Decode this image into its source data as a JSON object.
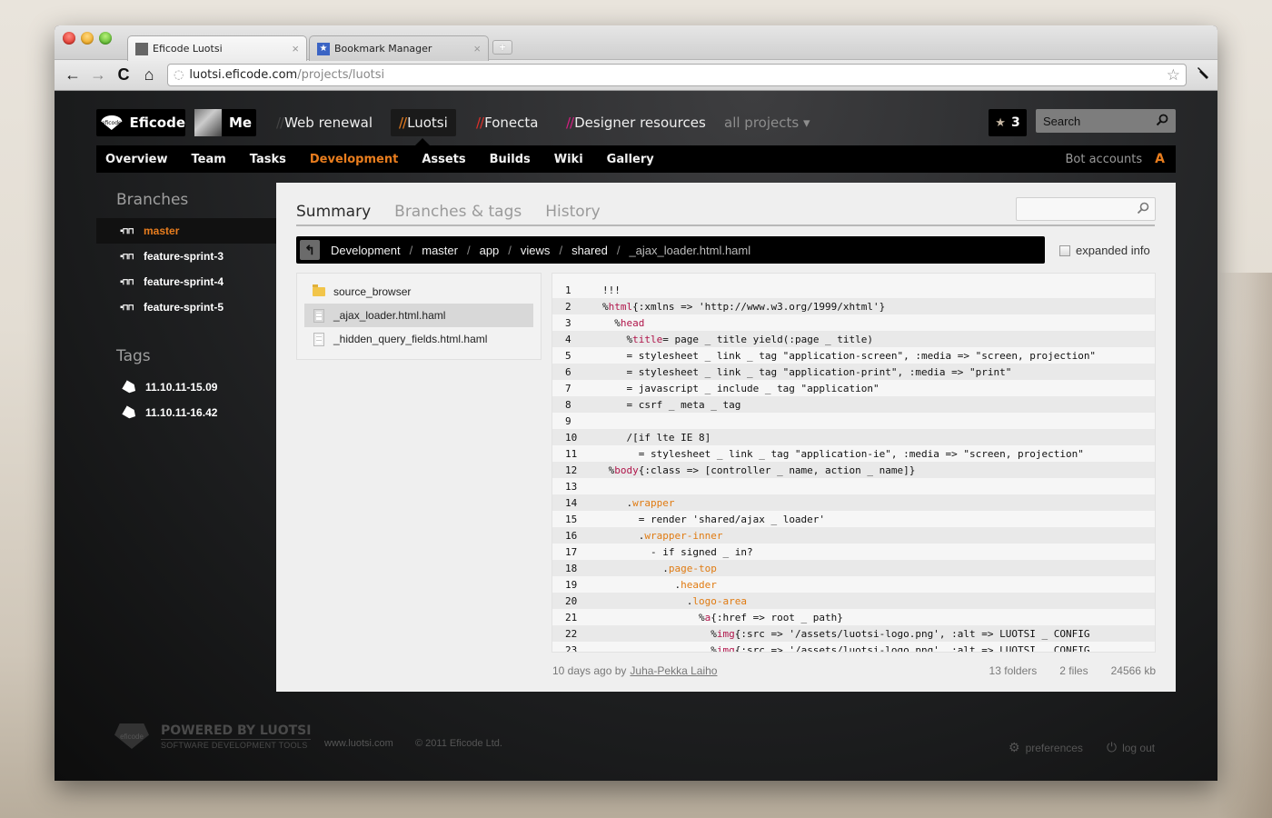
{
  "browser": {
    "tabs": [
      {
        "label": "Eficode Luotsi",
        "favicon": "eficode-favicon",
        "active": true
      },
      {
        "label": "Bookmark Manager",
        "favicon": "bookmark-star-favicon",
        "active": false
      }
    ],
    "tab_close_glyph": "×",
    "new_tab_glyph": "+",
    "url_host": "luotsi.eficode.com",
    "url_path": "/projects/luotsi",
    "icons": {
      "back": "←",
      "forward": "→",
      "reload": "C",
      "home": "⌂",
      "globe": "◌",
      "bookmark_star": "☆",
      "wrench": "🔧"
    }
  },
  "topnav": {
    "logo_label": "Eficode",
    "logo_mark_text": "eficode",
    "me_label": "Me",
    "projects": [
      {
        "slashes": "//",
        "label": "Web renewal",
        "slash_color": "#444444",
        "active": false
      },
      {
        "slashes": "//",
        "label": "Luotsi",
        "slash_color": "#e87d1e",
        "active": true
      },
      {
        "slashes": "//",
        "label": "Fonecta",
        "slash_color": "#e0302a",
        "active": false
      },
      {
        "slashes": "//",
        "label": "Designer resources",
        "slash_color": "#d61f83",
        "active": false
      }
    ],
    "all_projects_label": "all projects ▾",
    "starred_count": "3",
    "star_glyph": "★",
    "search_placeholder": "Search",
    "search_glyph": "⚲"
  },
  "subnav": {
    "items": [
      {
        "label": "Overview",
        "active": false
      },
      {
        "label": "Team",
        "active": false
      },
      {
        "label": "Tasks",
        "active": false
      },
      {
        "label": "Development",
        "active": true
      },
      {
        "label": "Assets",
        "active": false
      },
      {
        "label": "Builds",
        "active": false
      },
      {
        "label": "Wiki",
        "active": false
      },
      {
        "label": "Gallery",
        "active": false
      }
    ],
    "bot_accounts_label": "Bot accounts",
    "bot_accounts_badge": "A"
  },
  "sidebar": {
    "branches_heading": "Branches",
    "branches": [
      {
        "label": "master",
        "active": true
      },
      {
        "label": "feature-sprint-3",
        "active": false
      },
      {
        "label": "feature-sprint-4",
        "active": false
      },
      {
        "label": "feature-sprint-5",
        "active": false
      }
    ],
    "branch_glyph": "▪⁂",
    "tags_heading": "Tags",
    "tags": [
      {
        "label": "11.10.11-15.09"
      },
      {
        "label": "11.10.11-16.42"
      }
    ]
  },
  "main": {
    "tabs": [
      {
        "label": "Summary",
        "active": true
      },
      {
        "label": "Branches & tags",
        "active": false
      },
      {
        "label": "History",
        "active": false
      }
    ],
    "search_value": "",
    "search_glyph": "⚲",
    "back_glyph": "↰",
    "breadcrumb": [
      "Development",
      "master",
      "app",
      "views",
      "shared",
      "_ajax_loader.html.haml"
    ],
    "breadcrumb_sep": "/",
    "expanded_info_label": "expanded info",
    "expanded_info_checked": false,
    "files": [
      {
        "name": "source_browser",
        "type": "folder",
        "selected": false
      },
      {
        "name": "_ajax_loader.html.haml",
        "type": "file",
        "selected": true
      },
      {
        "name": "_hidden_query_fields.html.haml",
        "type": "file",
        "selected": false
      }
    ],
    "code_lines": [
      {
        "n": "1",
        "indent": 0,
        "parts": [
          {
            "t": "!!!"
          }
        ]
      },
      {
        "n": "2",
        "indent": 0,
        "parts": [
          {
            "t": "%"
          },
          {
            "t": "html",
            "c": "kw"
          },
          {
            "t": "{:xmlns => 'http://www.w3.org/1999/xhtml'}"
          }
        ]
      },
      {
        "n": "3",
        "indent": 2,
        "parts": [
          {
            "t": "%"
          },
          {
            "t": "head",
            "c": "kw"
          }
        ]
      },
      {
        "n": "4",
        "indent": 4,
        "parts": [
          {
            "t": "%"
          },
          {
            "t": "title",
            "c": "kw"
          },
          {
            "t": "= page _ title yield(:page _ title)"
          }
        ]
      },
      {
        "n": "5",
        "indent": 4,
        "parts": [
          {
            "t": "= stylesheet _ link _ tag \"application-screen\", :media => \"screen, projection\""
          }
        ]
      },
      {
        "n": "6",
        "indent": 4,
        "parts": [
          {
            "t": "= stylesheet _ link _ tag \"application-print\", :media => \"print\""
          }
        ]
      },
      {
        "n": "7",
        "indent": 4,
        "parts": [
          {
            "t": "= javascript _ include _ tag \"application\""
          }
        ]
      },
      {
        "n": "8",
        "indent": 4,
        "parts": [
          {
            "t": "= csrf _ meta _ tag"
          }
        ]
      },
      {
        "n": "9",
        "indent": 0,
        "parts": [
          {
            "t": ""
          }
        ]
      },
      {
        "n": "10",
        "indent": 4,
        "parts": [
          {
            "t": "/[if lte IE 8]"
          }
        ]
      },
      {
        "n": "11",
        "indent": 6,
        "parts": [
          {
            "t": "= stylesheet _ link _ tag \"application-ie\", :media => \"screen, projection\""
          }
        ]
      },
      {
        "n": "12",
        "indent": 1,
        "parts": [
          {
            "t": "%"
          },
          {
            "t": "body",
            "c": "kw"
          },
          {
            "t": "{:class => [controller _ name, action _ name]}"
          }
        ]
      },
      {
        "n": "13",
        "indent": 0,
        "parts": [
          {
            "t": ""
          }
        ]
      },
      {
        "n": "14",
        "indent": 4,
        "parts": [
          {
            "t": "."
          },
          {
            "t": "wrapper",
            "c": "cls"
          }
        ]
      },
      {
        "n": "15",
        "indent": 6,
        "parts": [
          {
            "t": "= render 'shared/ajax _ loader'"
          }
        ]
      },
      {
        "n": "16",
        "indent": 6,
        "parts": [
          {
            "t": "."
          },
          {
            "t": "wrapper-inner",
            "c": "cls"
          }
        ]
      },
      {
        "n": "17",
        "indent": 8,
        "parts": [
          {
            "t": "- if signed _ in?"
          }
        ]
      },
      {
        "n": "18",
        "indent": 10,
        "parts": [
          {
            "t": "."
          },
          {
            "t": "page-top",
            "c": "cls"
          }
        ]
      },
      {
        "n": "19",
        "indent": 12,
        "parts": [
          {
            "t": "."
          },
          {
            "t": "header",
            "c": "cls"
          }
        ]
      },
      {
        "n": "20",
        "indent": 14,
        "parts": [
          {
            "t": "."
          },
          {
            "t": "logo-area",
            "c": "cls"
          }
        ]
      },
      {
        "n": "21",
        "indent": 16,
        "parts": [
          {
            "t": "%"
          },
          {
            "t": "a",
            "c": "kw"
          },
          {
            "t": "{:href => root _ path}"
          }
        ]
      },
      {
        "n": "22",
        "indent": 18,
        "parts": [
          {
            "t": "%"
          },
          {
            "t": "img",
            "c": "kw"
          },
          {
            "t": "{:src => '/assets/luotsi-logo.png', :alt => LUOTSI _ CONFIG"
          }
        ]
      },
      {
        "n": "23",
        "indent": 18,
        "parts": [
          {
            "t": "%"
          },
          {
            "t": "img",
            "c": "kw"
          },
          {
            "t": "{:src => '/assets/luotsi-logo.png', :alt => LUOTSI _ CONFIG"
          }
        ]
      }
    ],
    "commit_age": "10 days ago by",
    "commit_author": "Juha-Pekka Laiho",
    "stats": {
      "folders": "13 folders",
      "files": "2 files",
      "size": "24566 kb"
    }
  },
  "footer": {
    "logo_text": "eficode",
    "powered_by": "POWERED BY LUOTSI",
    "tagline": "SOFTWARE DEVELOPMENT TOOLS",
    "site_link": "www.luotsi.com",
    "copyright": "© 2011 Eficode Ltd.",
    "preferences_label": "preferences",
    "preferences_glyph": "⚙",
    "logout_label": "log out",
    "logout_glyph": "⏻"
  },
  "colors": {
    "accent_orange": "#e87d1e",
    "haml_tag": "#b0154a",
    "haml_class": "#e07b12"
  }
}
